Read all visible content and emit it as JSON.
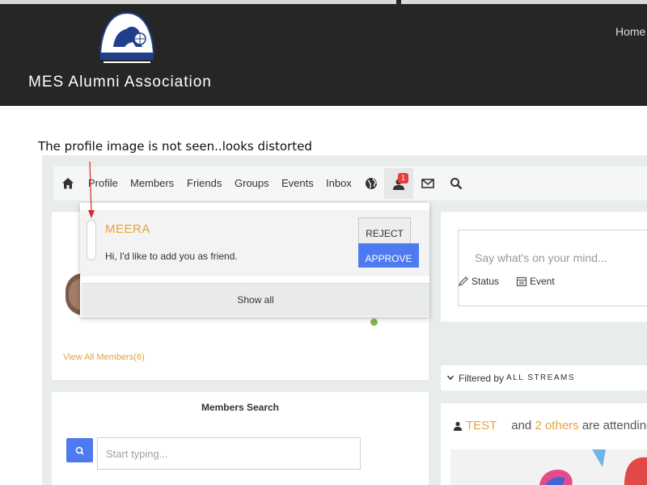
{
  "header": {
    "site_name": "MES Alumni Association",
    "nav_home": "Home"
  },
  "annotation": {
    "text": "The profile image is not seen..looks distorted"
  },
  "navbar": {
    "icons": [
      "home-icon",
      "globe-icon",
      "friend-requests-icon",
      "mail-icon",
      "search-icon"
    ],
    "links": [
      "Profile",
      "Members",
      "Friends",
      "Groups",
      "Events",
      "Inbox"
    ],
    "badge_count": "1"
  },
  "friend_request": {
    "name": "MEERA",
    "message": "Hi, I'd like to add you as friend.",
    "reject_label": "REJECT",
    "approve_label": "APPROVE",
    "show_all_label": "Show all"
  },
  "members_panel": {
    "view_all_label": "View All Members(6)"
  },
  "members_search": {
    "title": "Members Search",
    "placeholder": "Start typing..."
  },
  "post_box": {
    "placeholder": "Say what's on your mind...",
    "status_label": "Status",
    "event_label": "Event"
  },
  "stream_filter": {
    "label": "Filtered by",
    "value": "ALL STREAMS"
  },
  "activity": {
    "event_name": "TEST",
    "joiner": "and",
    "others": "2 others",
    "suffix": "are attending"
  },
  "colors": {
    "header_bg": "#262626",
    "accent_orange": "#e8a33f",
    "button_blue": "#4d7af0",
    "badge_red": "#e33d3d",
    "annotation_arrow": "#d42a2a"
  }
}
